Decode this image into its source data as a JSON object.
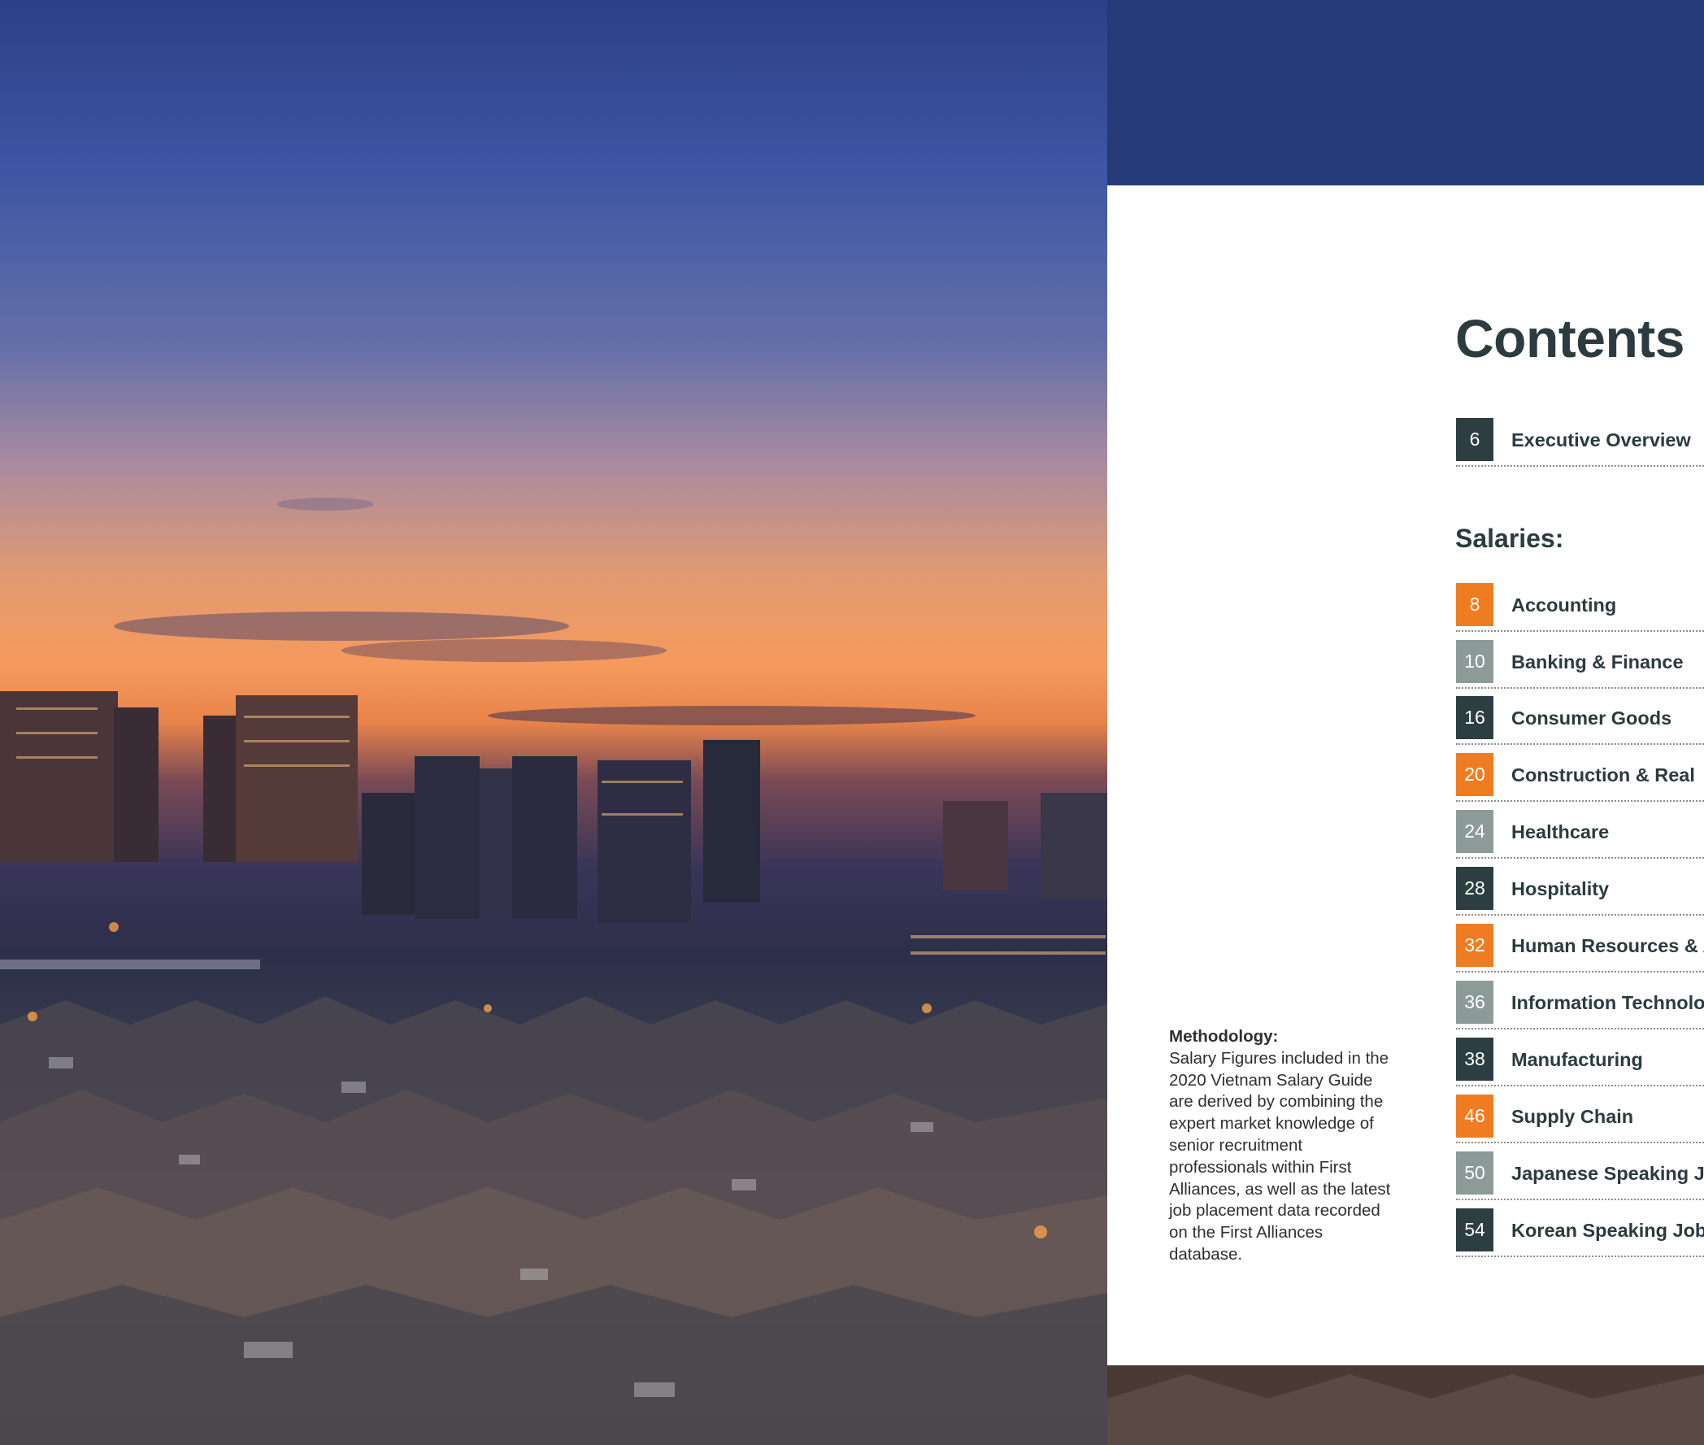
{
  "methodology": {
    "heading": "Methodology:",
    "body": "Salary Figures included in the 2020 Vietnam Salary Guide are derived by combining the expert market knowledge of senior recruitment professionals within First Alliances, as well as the latest job placement data recorded on the First Alliances database."
  },
  "contents": {
    "title": "Contents",
    "overview": {
      "num": "6",
      "label": "Executive Overview",
      "color": "#2c3e42"
    },
    "section_heading": "Salaries:",
    "items": [
      {
        "num": "8",
        "label": "Accounting",
        "color": "#f07c22"
      },
      {
        "num": "10",
        "label": "Banking & Finance",
        "color": "#8d9b98"
      },
      {
        "num": "16",
        "label": "Consumer Goods",
        "color": "#2c3e42"
      },
      {
        "num": "20",
        "label": "Construction & Real",
        "color": "#f07c22"
      },
      {
        "num": "24",
        "label": "Healthcare",
        "color": "#8d9b98"
      },
      {
        "num": "28",
        "label": "Hospitality",
        "color": "#2c3e42"
      },
      {
        "num": "32",
        "label": "Human Resources & A",
        "color": "#f07c22"
      },
      {
        "num": "36",
        "label": "Information Technolo",
        "color": "#8d9b98"
      },
      {
        "num": "38",
        "label": "Manufacturing",
        "color": "#2c3e42"
      },
      {
        "num": "46",
        "label": "Supply Chain",
        "color": "#f07c22"
      },
      {
        "num": "50",
        "label": "Japanese Speaking J",
        "color": "#8d9b98"
      },
      {
        "num": "54",
        "label": "Korean Speaking Job",
        "color": "#2c3e42"
      }
    ]
  },
  "colors": {
    "accent_orange": "#f07c22",
    "accent_grey": "#8d9b98",
    "accent_dark": "#2c3e42",
    "text_dark": "#2b3b3f"
  }
}
